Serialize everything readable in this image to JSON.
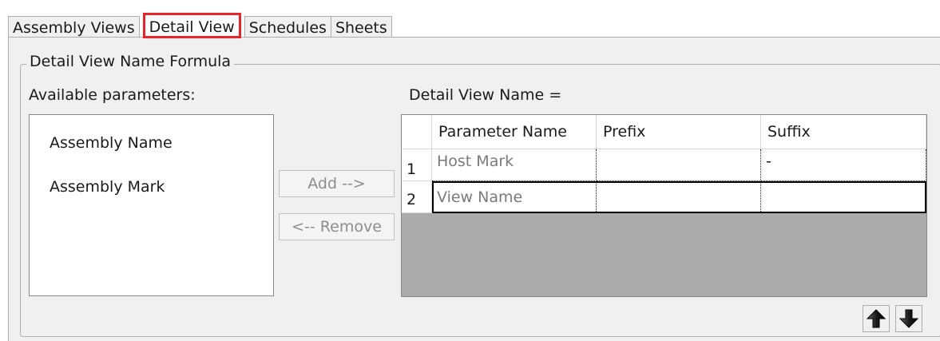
{
  "tabs": [
    {
      "label": "Assembly Views",
      "active": false
    },
    {
      "label": "Detail View",
      "active": true
    },
    {
      "label": "Schedules",
      "active": false
    },
    {
      "label": "Sheets",
      "active": false
    }
  ],
  "group": {
    "title": "Detail View Name Formula"
  },
  "available": {
    "label": "Available parameters:",
    "items": [
      "Assembly Name",
      "Assembly Mark"
    ]
  },
  "buttons": {
    "add_label": "Add -->",
    "remove_label": "<-- Remove"
  },
  "formula": {
    "label": "Detail View Name ="
  },
  "table": {
    "columns": [
      "Parameter Name",
      "Prefix",
      "Suffix"
    ],
    "rows": [
      {
        "index": "1",
        "parameter": "Host Mark",
        "prefix": "",
        "suffix": "-"
      },
      {
        "index": "2",
        "parameter": "View Name",
        "prefix": "",
        "suffix": ""
      }
    ]
  },
  "icons": {
    "move_up": "arrow-up-icon",
    "move_down": "arrow-down-icon"
  },
  "colors": {
    "active_tab_highlight": "#e3262b",
    "panel_background": "#f0f0f0"
  }
}
